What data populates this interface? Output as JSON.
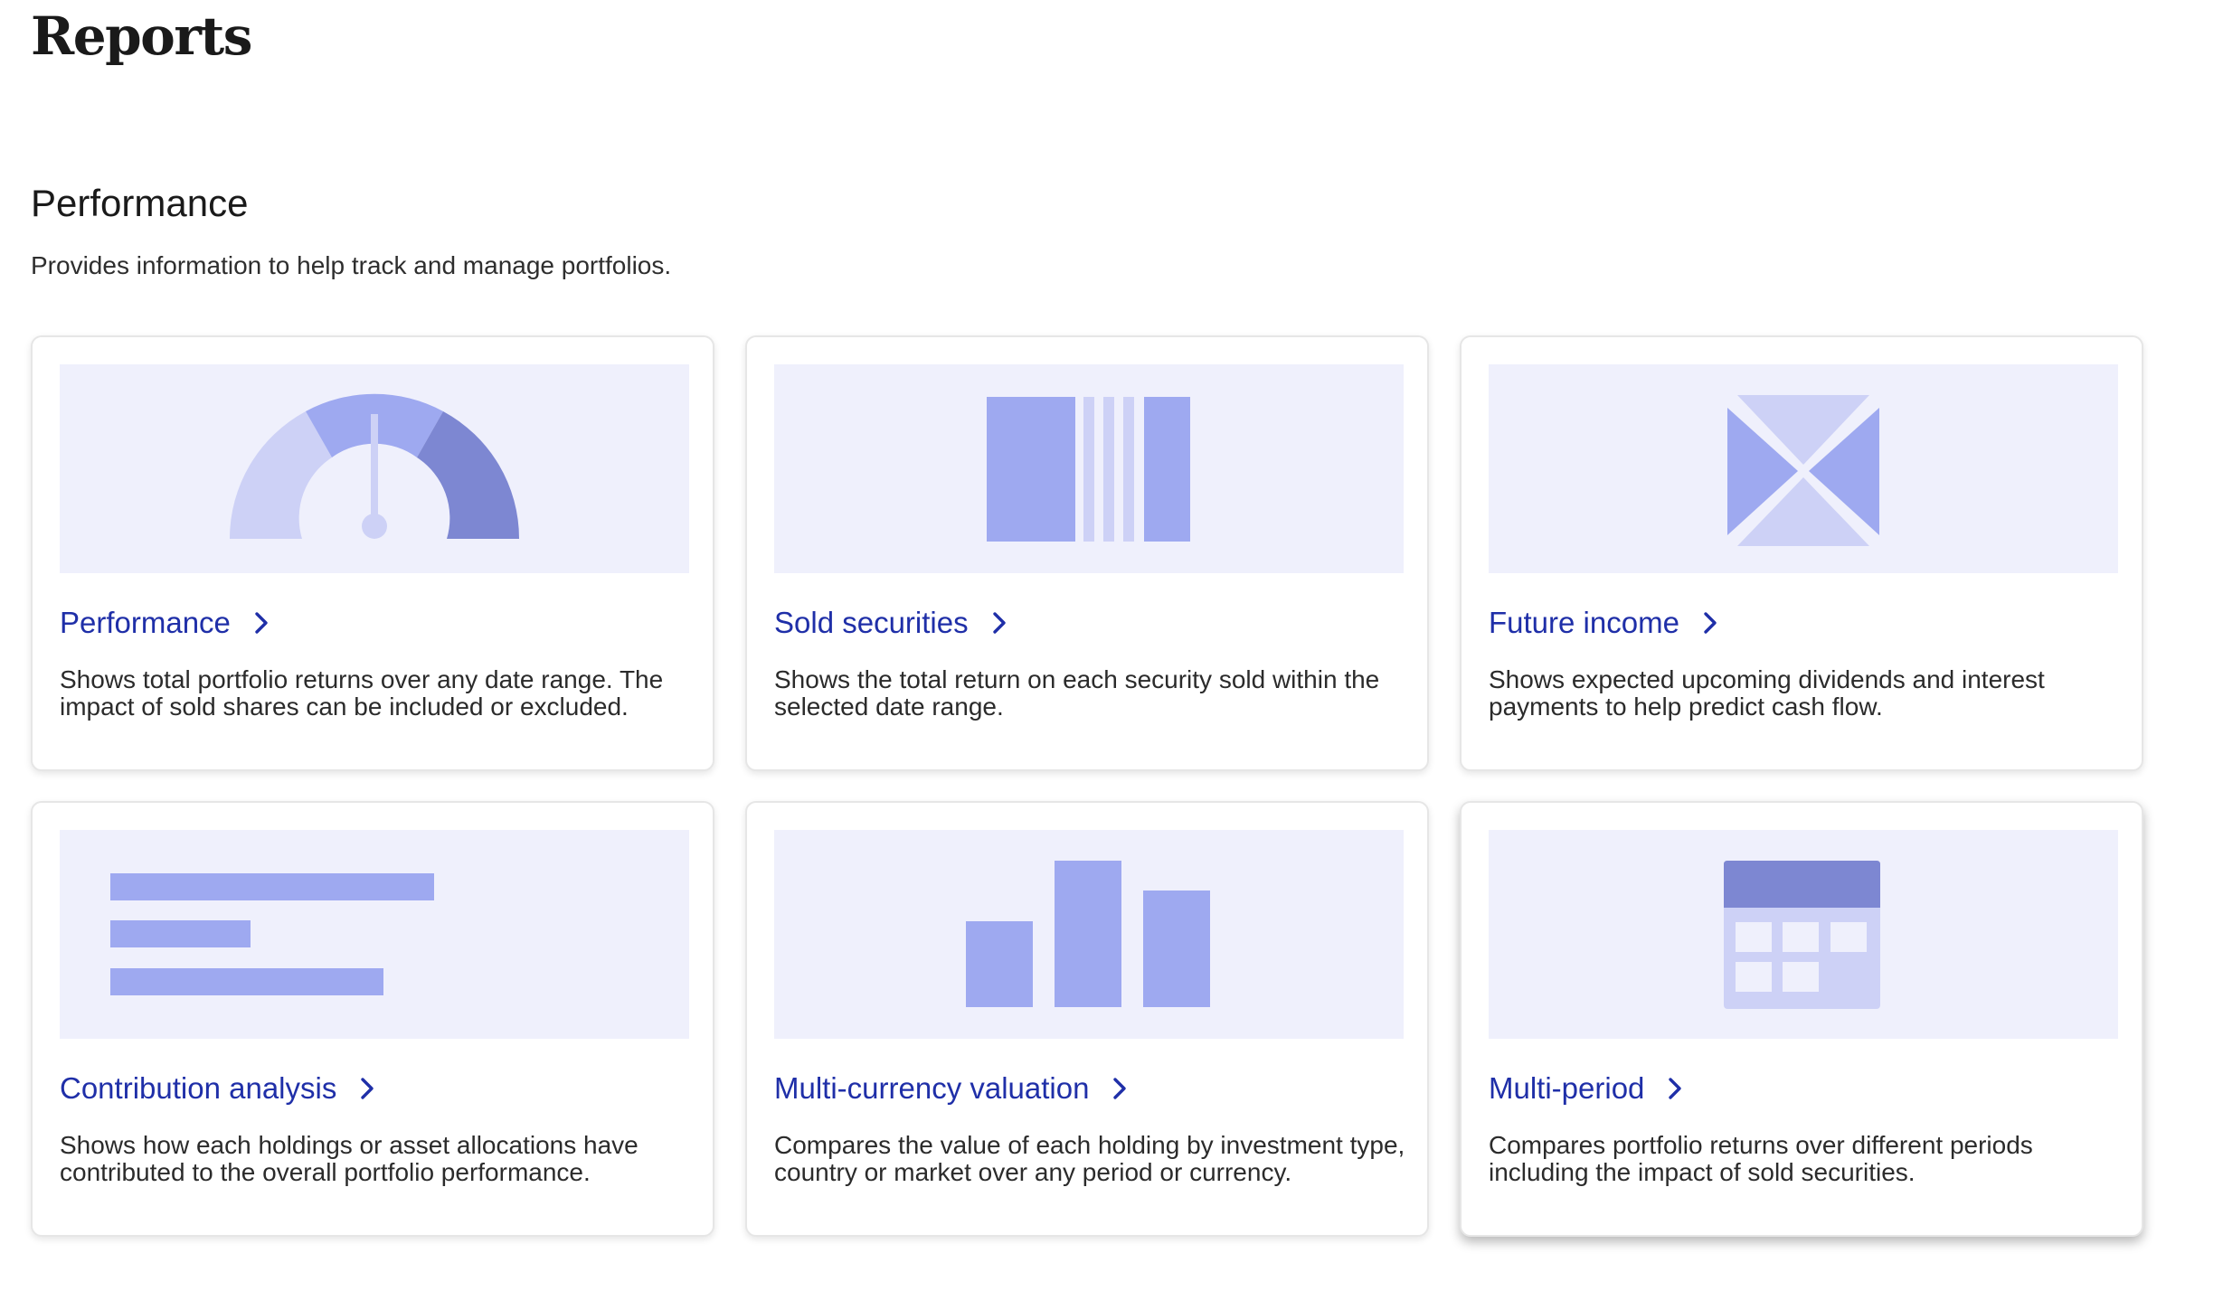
{
  "page": {
    "title": "Reports"
  },
  "section": {
    "title": "Performance",
    "description": "Provides information to help track and manage portfolios."
  },
  "colors": {
    "illustration_bg": "#eff0fc",
    "light": "#cdd1f6",
    "mid": "#9ea9f0",
    "dark": "#7d87d2",
    "link": "#1f2fa8"
  },
  "cards": [
    {
      "title": "Performance",
      "icon": "gauge-illustration",
      "description": "Shows total portfolio returns over any date range. The impact of sold shares can be included or excluded."
    },
    {
      "title": "Sold securities",
      "icon": "barcode-bars-illustration",
      "description": "Shows the total return on each security sold within the selected date range."
    },
    {
      "title": "Future income",
      "icon": "envelope-x-illustration",
      "description": "Shows expected upcoming dividends and interest payments to help predict cash flow."
    },
    {
      "title": "Contribution analysis",
      "icon": "horizontal-bars-illustration",
      "description": "Shows how each holdings or asset allocations have contributed to the overall portfolio performance."
    },
    {
      "title": "Multi-currency valuation",
      "icon": "vertical-bars-illustration",
      "description": "Compares the value of each holding by investment type, country or market over any period or currency."
    },
    {
      "title": "Multi-period",
      "icon": "calendar-illustration",
      "description": "Compares portfolio returns over different periods including the impact of sold securities."
    }
  ]
}
